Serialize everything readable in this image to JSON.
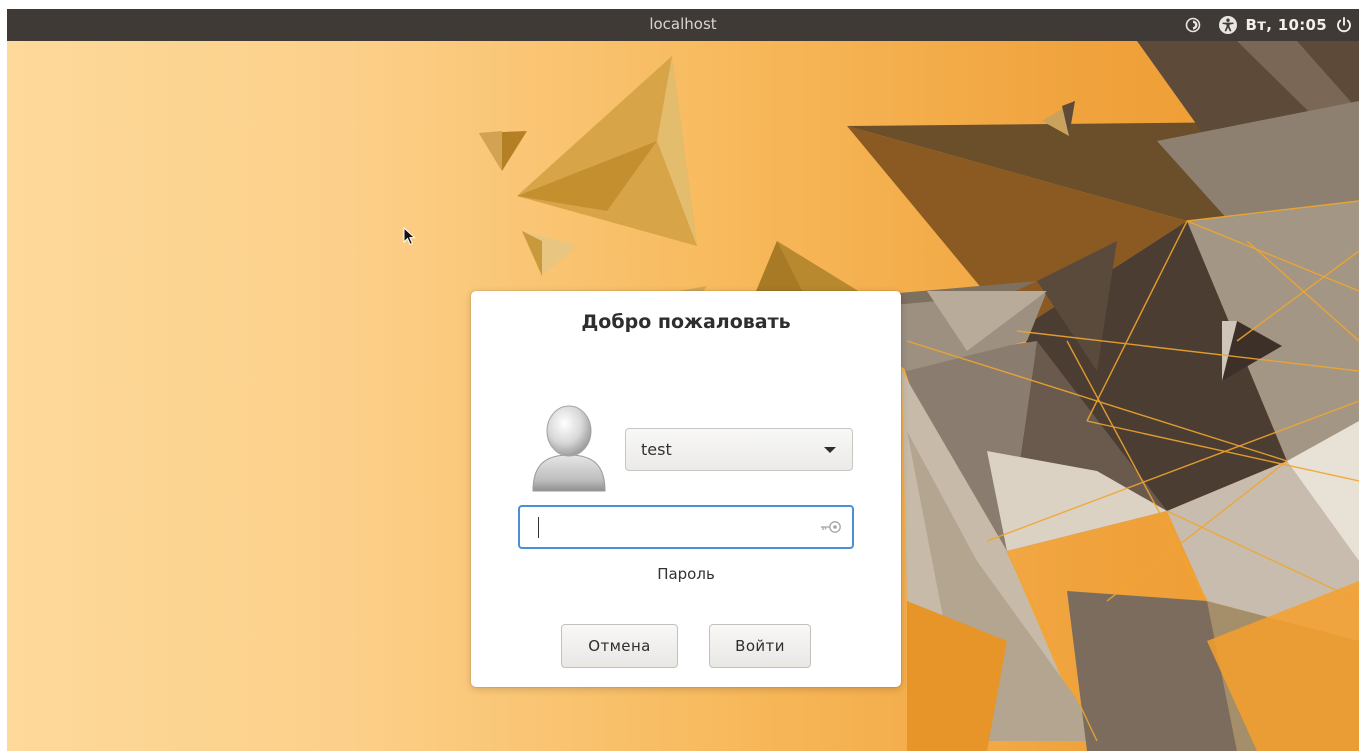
{
  "topbar": {
    "hostname": "localhost",
    "clock": "Вт, 10:05",
    "icons": [
      "display-icon",
      "accessibility-icon",
      "power-icon"
    ]
  },
  "dialog": {
    "title": "Добро пожаловать",
    "user": {
      "avatar": "user-avatar-icon",
      "selected": "test"
    },
    "password": {
      "value": "",
      "label": "Пароль",
      "icon": "key-icon"
    },
    "buttons": {
      "cancel": "Отмена",
      "login": "Войти"
    }
  },
  "colors": {
    "topbar_bg": "#3f3a36",
    "focus_border": "#4a90d9",
    "wallpaper_accent": "#f0a23c"
  }
}
